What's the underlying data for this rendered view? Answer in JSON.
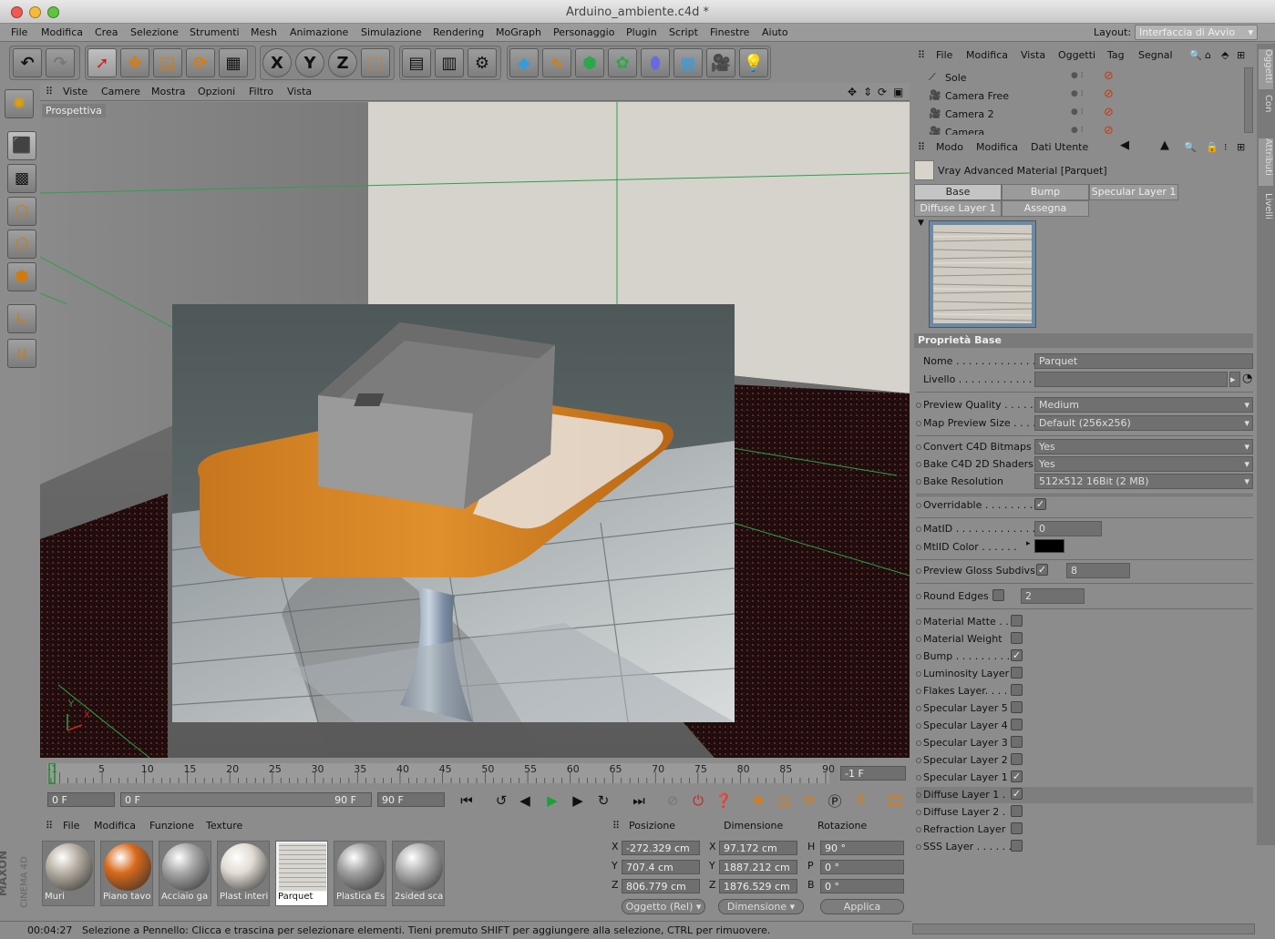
{
  "window": {
    "title": "Arduino_ambiente.c4d *"
  },
  "menubar": {
    "items": [
      "File",
      "Modifica",
      "Crea",
      "Selezione",
      "Strumenti",
      "Mesh",
      "Animazione",
      "Simulazione",
      "Rendering",
      "MoGraph",
      "Personaggio",
      "Plugin",
      "Script",
      "Finestre",
      "Aiuto"
    ],
    "layout_label": "Layout:",
    "layout_value": "Interfaccia di Avvio"
  },
  "toolbar": {
    "axis_x": "X",
    "axis_y": "Y",
    "axis_z": "Z"
  },
  "viewport": {
    "menu": [
      "Viste",
      "Camere",
      "Mostra",
      "Opzioni",
      "Filtro",
      "Vista"
    ],
    "label": "Prospettiva",
    "axis_x": "X",
    "axis_y": "Y"
  },
  "timeline": {
    "ticks": [
      "-1",
      "5",
      "10",
      "15",
      "20",
      "25",
      "30",
      "35",
      "40",
      "45",
      "50",
      "55",
      "60",
      "65",
      "70",
      "75",
      "80",
      "85",
      "90"
    ],
    "end_field": "-1 F"
  },
  "transport": {
    "start": "0 F",
    "range_start": "0 F",
    "range_end": "90 F",
    "end": "90 F"
  },
  "materials": {
    "menu": [
      "File",
      "Modifica",
      "Funzione",
      "Texture"
    ],
    "items": [
      {
        "name": "Muri",
        "color": "#b8b0a4"
      },
      {
        "name": "Piano tavo",
        "color": "#d86a1c"
      },
      {
        "name": "Acciaio ga",
        "color": "#a8a8a8"
      },
      {
        "name": "Plast interi",
        "color": "#e2dcd4"
      },
      {
        "name": "Parquet",
        "color": "#d8d6d0"
      },
      {
        "name": "Plastica Es",
        "color": "#a0a0a0"
      },
      {
        "name": "2sided sca",
        "color": "#b0b0b0"
      }
    ]
  },
  "coordinates": {
    "headers": [
      "Posizione",
      "Dimensione",
      "Rotazione"
    ],
    "rows": [
      {
        "axis": "X",
        "pos": "-272.329 cm",
        "dim_axis": "X",
        "dim": "97.172 cm",
        "rot_axis": "H",
        "rot": "90 °"
      },
      {
        "axis": "Y",
        "pos": "707.4 cm",
        "dim_axis": "Y",
        "dim": "1887.212 cm",
        "rot_axis": "P",
        "rot": "0 °"
      },
      {
        "axis": "Z",
        "pos": "806.779 cm",
        "dim_axis": "Z",
        "dim": "1876.529 cm",
        "rot_axis": "B",
        "rot": "0 °"
      }
    ],
    "mode_select": "Oggetto (Rel)",
    "dim_select": "Dimensione",
    "apply": "Applica"
  },
  "status": {
    "time": "00:04:27",
    "message": "Selezione a Pennello: Clicca e trascina per selezionare elementi. Tieni premuto SHIFT per aggiungere alla selezione, CTRL per rimuovere."
  },
  "object_manager": {
    "menu": [
      "File",
      "Modifica",
      "Vista",
      "Oggetti",
      "Tag",
      "Segnal"
    ],
    "objects": [
      "Sole",
      "Camera Free",
      "Camera 2",
      "Camera"
    ]
  },
  "attributes": {
    "menu": [
      "Modo",
      "Modifica",
      "Dati Utente"
    ],
    "material_title": "Vray Advanced Material [Parquet]",
    "tabs_row1": [
      "Base",
      "Bump",
      "Specular Layer 1"
    ],
    "tabs_row2": [
      "Diffuse Layer 1",
      "Assegna"
    ],
    "section": "Proprietà Base",
    "name_label": "Nome . . . . . . . . . . . . . .",
    "name_value": "Parquet",
    "level_label": "Livello . . . . . . . . . . . . .",
    "props": [
      {
        "label": "Preview Quality . . . . . .",
        "value": "Medium"
      },
      {
        "label": "Map Preview Size . . . .",
        "value": "Default (256x256)"
      },
      {
        "label": "Convert C4D Bitmaps",
        "value": "Yes"
      },
      {
        "label": "Bake C4D 2D Shaders",
        "value": "Yes"
      },
      {
        "label": "Bake Resolution",
        "value": "512x512  16Bit  (2 MB)"
      }
    ],
    "overridable_label": "Overridable . . . . . . . . .",
    "matid_label": "MatID . . . . . . . . . . . . . .",
    "matid_value": "0",
    "mtlid_color_label": "MtlID Color . . . . . .",
    "gloss_label": "Preview Gloss Subdivs",
    "gloss_value": "8",
    "round_label": "Round Edges",
    "round_value": "2",
    "layers": [
      {
        "label": "Material Matte . .",
        "checked": false
      },
      {
        "label": "Material Weight",
        "checked": false
      },
      {
        "label": "Bump . . . . . . . . . .",
        "checked": true
      },
      {
        "label": "Luminosity Layer",
        "checked": false
      },
      {
        "label": "Flakes Layer. . . .",
        "checked": false
      },
      {
        "label": "Specular Layer 5",
        "checked": false
      },
      {
        "label": "Specular Layer 4",
        "checked": false
      },
      {
        "label": "Specular Layer 3",
        "checked": false
      },
      {
        "label": "Specular Layer 2",
        "checked": false
      },
      {
        "label": "Specular Layer 1",
        "checked": true
      },
      {
        "label": "Diffuse Layer 1 .",
        "checked": true
      },
      {
        "label": "Diffuse Layer 2 .",
        "checked": false
      },
      {
        "label": "Refraction Layer",
        "checked": false
      },
      {
        "label": "SSS Layer . . . . . .",
        "checked": false
      }
    ]
  },
  "right_tabs": [
    "Oggetti",
    "Con",
    "Attributi",
    "Livelli"
  ],
  "brand": {
    "maxon": "MAXON",
    "cinema": "CINEMA 4D"
  }
}
